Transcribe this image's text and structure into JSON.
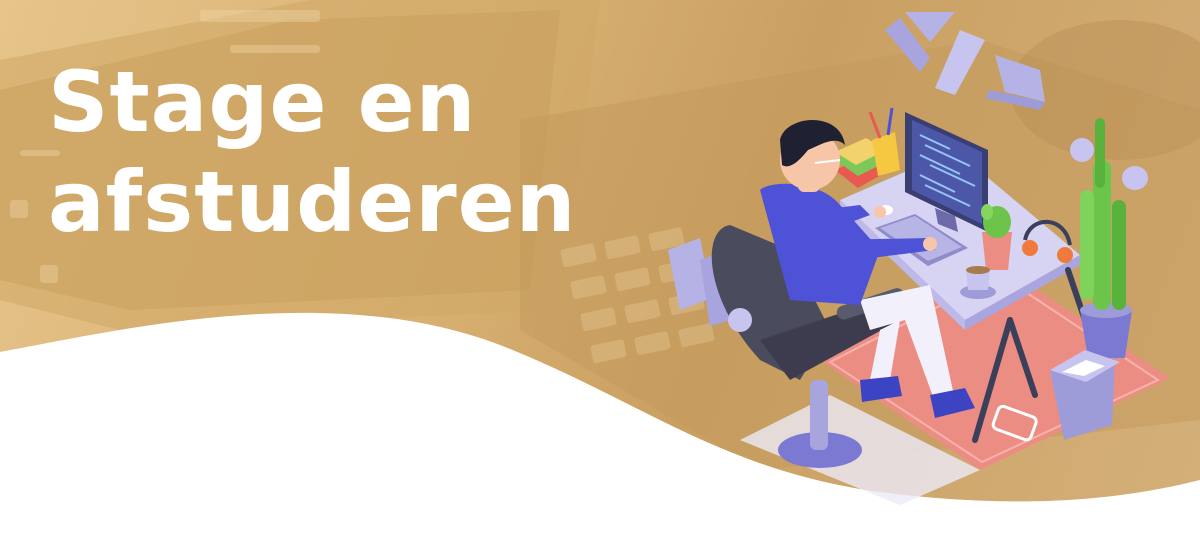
{
  "hero": {
    "title_line_1": "Stage en",
    "title_line_2": "afstuderen"
  },
  "colors": {
    "background": "#d9b274",
    "title_text": "#ffffff",
    "wave": "#ffffff",
    "floor_mat": "#ec8d84",
    "shirt": "#4e52d6",
    "monitor": "#3a3f73",
    "plant": "#6cc44a"
  },
  "icons": {
    "code": "code-tag-icon",
    "illustration": "developer-at-desk-illustration"
  }
}
